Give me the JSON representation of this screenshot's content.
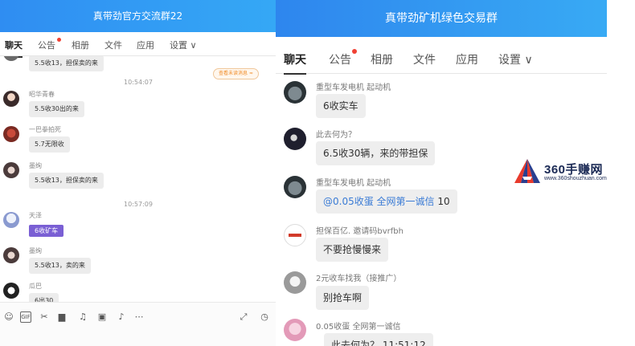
{
  "left": {
    "title": "真带劲官方交流群22",
    "tabs": [
      "聊天",
      "公告",
      "相册",
      "文件",
      "应用",
      "设置 ∨"
    ],
    "notice_pill": "查看未读消息 ≈",
    "times": [
      "10:54:07",
      "10:57:09"
    ],
    "messages": [
      {
        "name": "",
        "text": "5.5收13，担保卖的来"
      },
      {
        "name": "昭华青春",
        "text": "5.5收30出的来"
      },
      {
        "name": "一巴拳拍死",
        "text": "5.7无限收"
      },
      {
        "name": "墨绚",
        "text": "5.5收13，担保卖的来"
      },
      {
        "name": "天泽",
        "text": "6收矿车"
      },
      {
        "name": "墨绚",
        "text": "5.5收13，卖的来"
      },
      {
        "name": "瓜巴",
        "text": "6出30"
      }
    ],
    "toolbar": [
      "emoji-icon",
      "gif-icon",
      "scissors-icon",
      "folder-icon",
      "music-icon",
      "image-icon",
      "mute-bell-icon",
      "more-icon",
      "expand-icon",
      "history-icon"
    ]
  },
  "right": {
    "title": "真带劲矿机绿色交易群",
    "tabs": [
      "聊天",
      "公告",
      "相册",
      "文件",
      "应用",
      "设置 ∨"
    ],
    "messages": [
      {
        "name": "重型车发电机 起动机",
        "text": "6收实车"
      },
      {
        "name": "此去何为？",
        "text": "6.5收30辆，来的带担保"
      },
      {
        "name": "重型车发电机 起动机",
        "text_blue": "@0.05收蛋  全网第一诚信",
        "text_rest": " 10"
      },
      {
        "name": "担保百亿. 邀请码bvrfbh",
        "text": "不要抢慢慢来"
      },
      {
        "name": "2元收车找我（接推广）",
        "text": "别抢车啊"
      },
      {
        "name": "0.05收蛋  全网第一诚信",
        "text": "此去何为？  11:51:12"
      }
    ]
  },
  "watermark": {
    "brand": "360手赚网",
    "url": "www.360shouzhuan.com"
  },
  "colors": {
    "title_bar": "#2f8df2",
    "unread_dot": "#f04134",
    "mention_blue": "#3a7bd5",
    "purple_bubble": "#7a5fd4"
  }
}
